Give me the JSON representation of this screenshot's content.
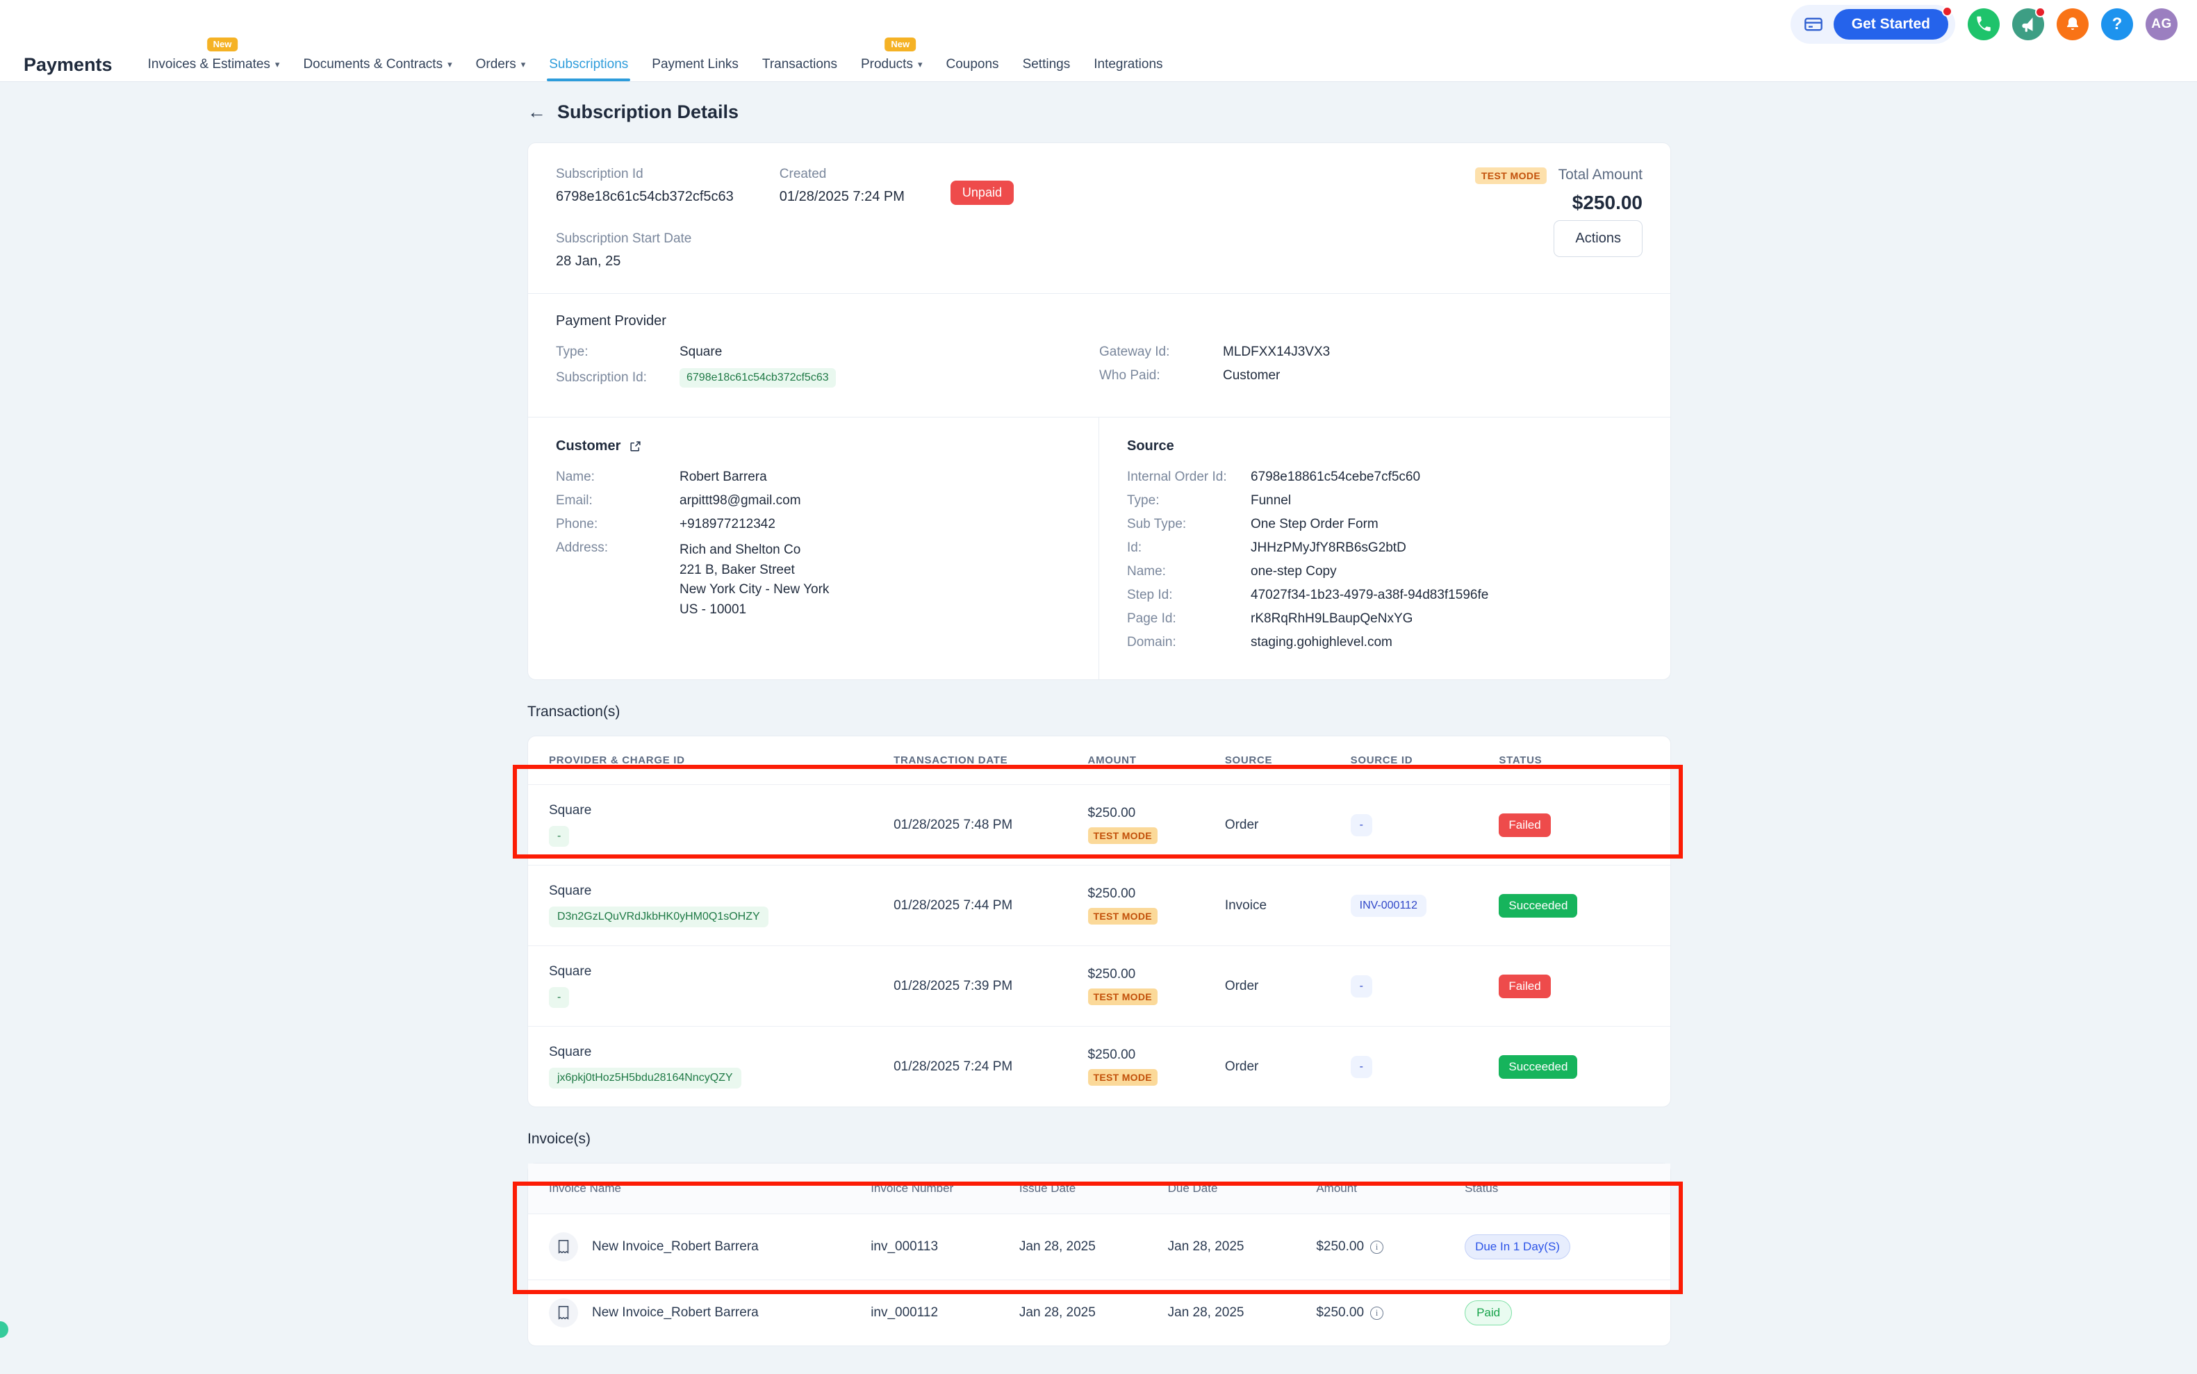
{
  "topbar": {
    "card_icon": "credit-card-icon",
    "get_started_label": "Get Started",
    "icons": [
      {
        "name": "phone-icon",
        "glyph": "✆",
        "color": "#1ec36b",
        "badge": false
      },
      {
        "name": "megaphone-icon",
        "glyph": "★",
        "color": "#3d9e84",
        "badge": true
      },
      {
        "name": "notification-bell-icon",
        "glyph": "★",
        "color": "#f97316",
        "badge": false
      },
      {
        "name": "help-icon",
        "glyph": "?",
        "color": "#1d93ee",
        "badge": false
      }
    ],
    "avatar_initials": "AG"
  },
  "nav": {
    "brand": "Payments",
    "items": [
      {
        "label": "Invoices & Estimates",
        "caret": true,
        "new": true,
        "active": false
      },
      {
        "label": "Documents & Contracts",
        "caret": true,
        "new": false,
        "active": false
      },
      {
        "label": "Orders",
        "caret": true,
        "new": false,
        "active": false
      },
      {
        "label": "Subscriptions",
        "caret": false,
        "new": false,
        "active": true
      },
      {
        "label": "Payment Links",
        "caret": false,
        "new": false,
        "active": false
      },
      {
        "label": "Transactions",
        "caret": false,
        "new": false,
        "active": false
      },
      {
        "label": "Products",
        "caret": true,
        "new": true,
        "active": false
      },
      {
        "label": "Coupons",
        "caret": false,
        "new": false,
        "active": false
      },
      {
        "label": "Settings",
        "caret": false,
        "new": false,
        "active": false
      },
      {
        "label": "Integrations",
        "caret": false,
        "new": false,
        "active": false
      }
    ],
    "new_tag": "New"
  },
  "page": {
    "title": "Subscription Details",
    "back_icon": "back-arrow-icon"
  },
  "summary": {
    "subscription_id_label": "Subscription Id",
    "subscription_id_value": "6798e18c61c54cb372cf5c63",
    "created_label": "Created",
    "created_value": "01/28/2025 7:24 PM",
    "status_badge": "Unpaid",
    "test_mode_badge": "TEST MODE",
    "total_amount_label": "Total Amount",
    "total_amount_value": "$250.00",
    "start_date_label": "Subscription Start Date",
    "start_date_value": "28 Jan, 25",
    "actions_label": "Actions"
  },
  "payment_provider": {
    "title": "Payment Provider",
    "type_label": "Type:",
    "type_value": "Square",
    "subscription_id_label": "Subscription Id:",
    "subscription_id_value": "6798e18c61c54cb372cf5c63",
    "gateway_id_label": "Gateway Id:",
    "gateway_id_value": "MLDFXX14J3VX3",
    "who_paid_label": "Who Paid:",
    "who_paid_value": "Customer"
  },
  "customer": {
    "title": "Customer",
    "external_link_icon": "external-link-icon",
    "name_label": "Name:",
    "name_value": "Robert Barrera",
    "email_label": "Email:",
    "email_value": "arpittt98@gmail.com",
    "phone_label": "Phone:",
    "phone_value": "+918977212342",
    "address_label": "Address:",
    "address_line1": "Rich and Shelton Co",
    "address_line2": "221 B, Baker Street",
    "address_line3": "New York City - New York",
    "address_line4": "US - 10001"
  },
  "source": {
    "title": "Source",
    "internal_order_id_label": "Internal Order Id:",
    "internal_order_id_value": "6798e18861c54cebe7cf5c60",
    "type_label": "Type:",
    "type_value": "Funnel",
    "sub_type_label": "Sub Type:",
    "sub_type_value": "One Step Order Form",
    "id_label": "Id:",
    "id_value": "JHHzPMyJfY8RB6sG2btD",
    "name_label": "Name:",
    "name_value": "one-step Copy",
    "step_id_label": "Step Id:",
    "step_id_value": "47027f34-1b23-4979-a38f-94d83f1596fe",
    "page_id_label": "Page Id:",
    "page_id_value": "rK8RqRhH9LBaupQeNxYG",
    "domain_label": "Domain:",
    "domain_value": "staging.gohighlevel.com"
  },
  "transactions": {
    "section_title": "Transaction(s)",
    "columns": [
      "PROVIDER & CHARGE ID",
      "TRANSACTION DATE",
      "AMOUNT",
      "SOURCE",
      "SOURCE ID",
      "STATUS"
    ],
    "rows": [
      {
        "provider": "Square",
        "charge_id": "-",
        "date": "01/28/2025 7:48 PM",
        "amount": "$250.00",
        "test_mode": "TEST MODE",
        "source": "Order",
        "source_id": "-",
        "source_id_kind": "dash",
        "status": "Failed",
        "status_kind": "failed",
        "highlighted": true
      },
      {
        "provider": "Square",
        "charge_id": "D3n2GzLQuVRdJkbHK0yHM0Q1sOHZY",
        "date": "01/28/2025 7:44 PM",
        "amount": "$250.00",
        "test_mode": "TEST MODE",
        "source": "Invoice",
        "source_id": "INV-000112",
        "source_id_kind": "link",
        "status": "Succeeded",
        "status_kind": "success",
        "highlighted": false
      },
      {
        "provider": "Square",
        "charge_id": "-",
        "date": "01/28/2025 7:39 PM",
        "amount": "$250.00",
        "test_mode": "TEST MODE",
        "source": "Order",
        "source_id": "-",
        "source_id_kind": "dash",
        "status": "Failed",
        "status_kind": "failed",
        "highlighted": false
      },
      {
        "provider": "Square",
        "charge_id": "jx6pkj0tHoz5H5bdu28164NncyQZY",
        "date": "01/28/2025 7:24 PM",
        "amount": "$250.00",
        "test_mode": "TEST MODE",
        "source": "Order",
        "source_id": "-",
        "source_id_kind": "dash",
        "status": "Succeeded",
        "status_kind": "success",
        "highlighted": false
      }
    ]
  },
  "invoices": {
    "section_title": "Invoice(s)",
    "columns": [
      "Invoice Name",
      "Invoice Number",
      "Issue Date",
      "Due Date",
      "Amount",
      "Status"
    ],
    "rows": [
      {
        "icon": "invoice-receipt-icon",
        "name": "New Invoice_Robert Barrera",
        "number": "inv_000113",
        "issue_date": "Jan 28, 2025",
        "due_date": "Jan 28, 2025",
        "amount": "$250.00",
        "info_icon": "info-icon",
        "status": "Due In 1 Day(S)",
        "status_kind": "due",
        "highlighted": true
      },
      {
        "icon": "invoice-receipt-icon",
        "name": "New Invoice_Robert Barrera",
        "number": "inv_000112",
        "issue_date": "Jan 28, 2025",
        "due_date": "Jan 28, 2025",
        "amount": "$250.00",
        "info_icon": "info-icon",
        "status": "Paid",
        "status_kind": "paid",
        "highlighted": false
      }
    ]
  },
  "colors": {
    "accent_blue": "#2d9cdb",
    "brand_blue": "#2563eb",
    "failed_red": "#ee4b4b",
    "success_green": "#16b45c",
    "test_mode_amber": "#fbd999",
    "annotation_red": "#fc1c05",
    "page_bg": "#eff4f8"
  }
}
